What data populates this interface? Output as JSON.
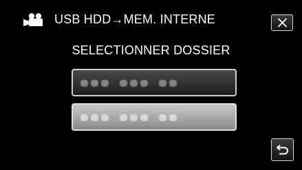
{
  "header": {
    "mode_icon": "movie-camera-icon",
    "title": "USB HDD→MEM. INTERNE",
    "close_icon": "close-icon"
  },
  "subtitle": "SELECTIONNER DOSSIER",
  "folders": [
    {
      "label": "",
      "state": "selected"
    },
    {
      "label": "",
      "state": "normal"
    }
  ],
  "footer": {
    "back_icon": "return-icon"
  },
  "colors": {
    "background": "#000000",
    "text": "#ffffff",
    "button_border": "#d8d8d8",
    "selected_button": "#2c2c2c",
    "normal_button": "#a8a8a8"
  }
}
